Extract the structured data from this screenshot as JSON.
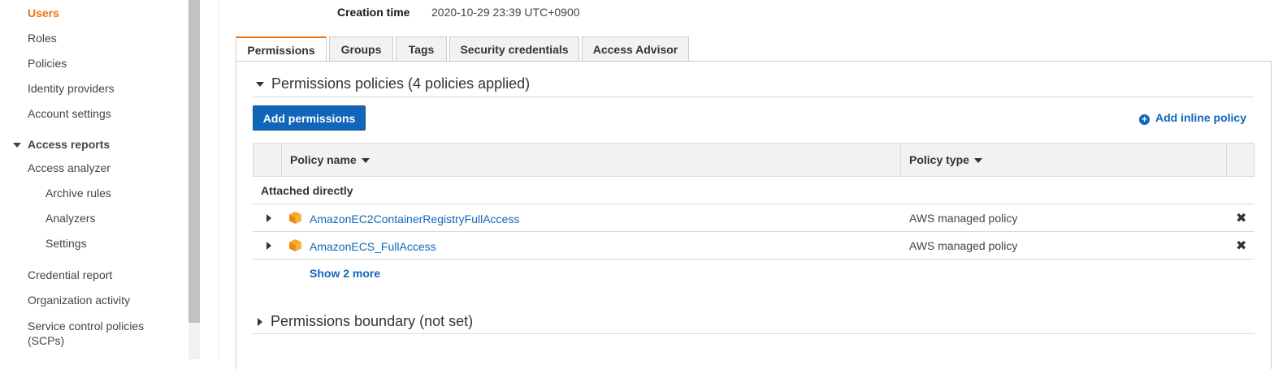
{
  "sidebar": {
    "items": [
      {
        "label": "Users",
        "active": true
      },
      {
        "label": "Roles"
      },
      {
        "label": "Policies"
      },
      {
        "label": "Identity providers"
      },
      {
        "label": "Account settings"
      }
    ],
    "section": {
      "label": "Access reports",
      "expanded": true
    },
    "section_items": [
      {
        "label": "Access analyzer"
      },
      {
        "label": "Archive rules"
      },
      {
        "label": "Analyzers"
      },
      {
        "label": "Settings"
      },
      {
        "label": "Credential report"
      },
      {
        "label": "Organization activity"
      },
      {
        "label": "Service control policies (SCPs)",
        "line1": "Service control policies",
        "line2": "(SCPs)"
      }
    ]
  },
  "summary": {
    "creation_label": "Creation time",
    "creation_value": "2020-10-29 23:39 UTC+0900"
  },
  "tabs": [
    {
      "label": "Permissions",
      "active": true
    },
    {
      "label": "Groups"
    },
    {
      "label": "Tags"
    },
    {
      "label": "Security credentials"
    },
    {
      "label": "Access Advisor"
    }
  ],
  "permissions": {
    "title": "Permissions policies (4 policies applied)",
    "add_button": "Add permissions",
    "inline_link": "Add inline policy",
    "columns": [
      "Policy name",
      "Policy type"
    ],
    "group_label": "Attached directly",
    "rows": [
      {
        "name": "AmazonEC2ContainerRegistryFullAccess",
        "type": "AWS managed policy",
        "icon": "cube-icon"
      },
      {
        "name": "AmazonECS_FullAccess",
        "type": "AWS managed policy",
        "icon": "cube-icon"
      }
    ],
    "show_more": "Show 2 more"
  },
  "boundary": {
    "title": "Permissions boundary (not set)"
  },
  "colors": {
    "accent": "#ec7211",
    "link": "#1166bb",
    "primary_button": "#1166bb"
  }
}
